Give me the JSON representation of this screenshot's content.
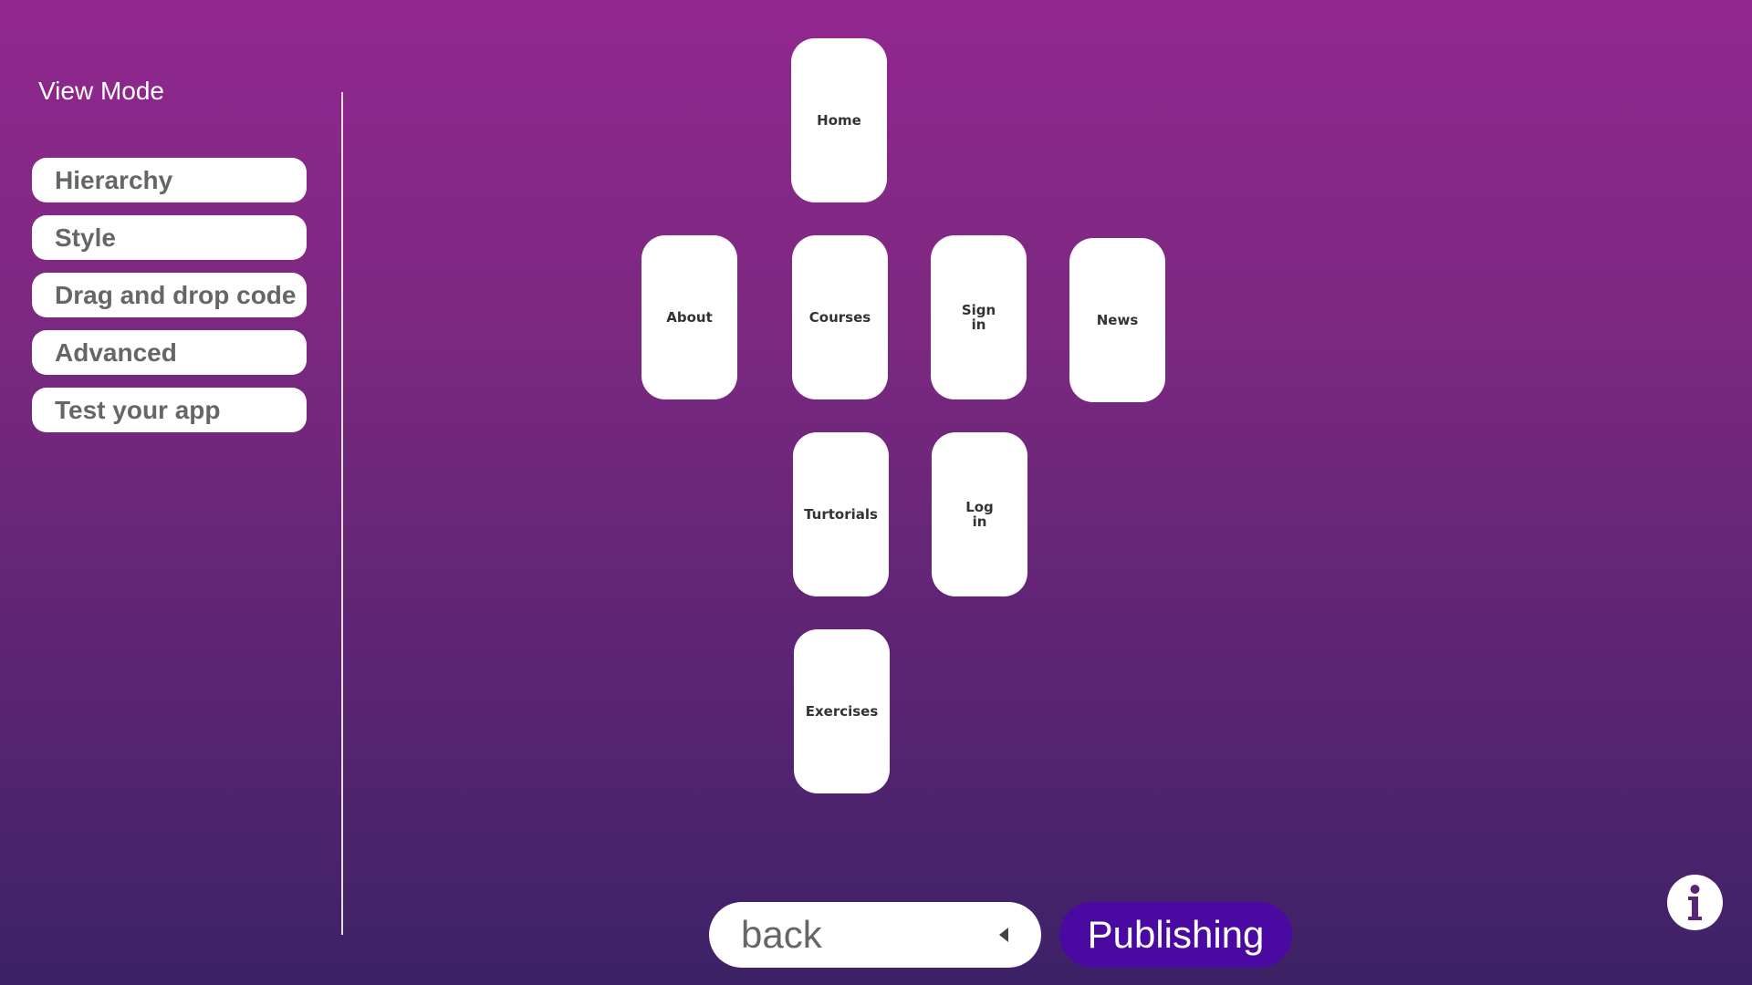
{
  "sidebar": {
    "title": "View Mode",
    "items": [
      {
        "label": "Hierarchy"
      },
      {
        "label": "Style"
      },
      {
        "label": "Drag and drop code"
      },
      {
        "label": "Advanced"
      },
      {
        "label": "Test your app"
      }
    ]
  },
  "pages": {
    "home": "Home",
    "about": "About",
    "courses": "Courses",
    "sign_in": "Sign in",
    "news": "News",
    "turtorials": "Turtorials",
    "log_in": "Log in",
    "exercises": "Exercises"
  },
  "footer": {
    "back_label": "back",
    "publish_label": "Publishing"
  },
  "icons": {
    "info": "info-icon",
    "back_arrow": "caret-left-icon"
  },
  "colors": {
    "background_top": "#92278f",
    "background_bottom": "#3c2266",
    "publish_button": "#4a0aa1",
    "card": "#ffffff",
    "menu_text": "#666666"
  }
}
